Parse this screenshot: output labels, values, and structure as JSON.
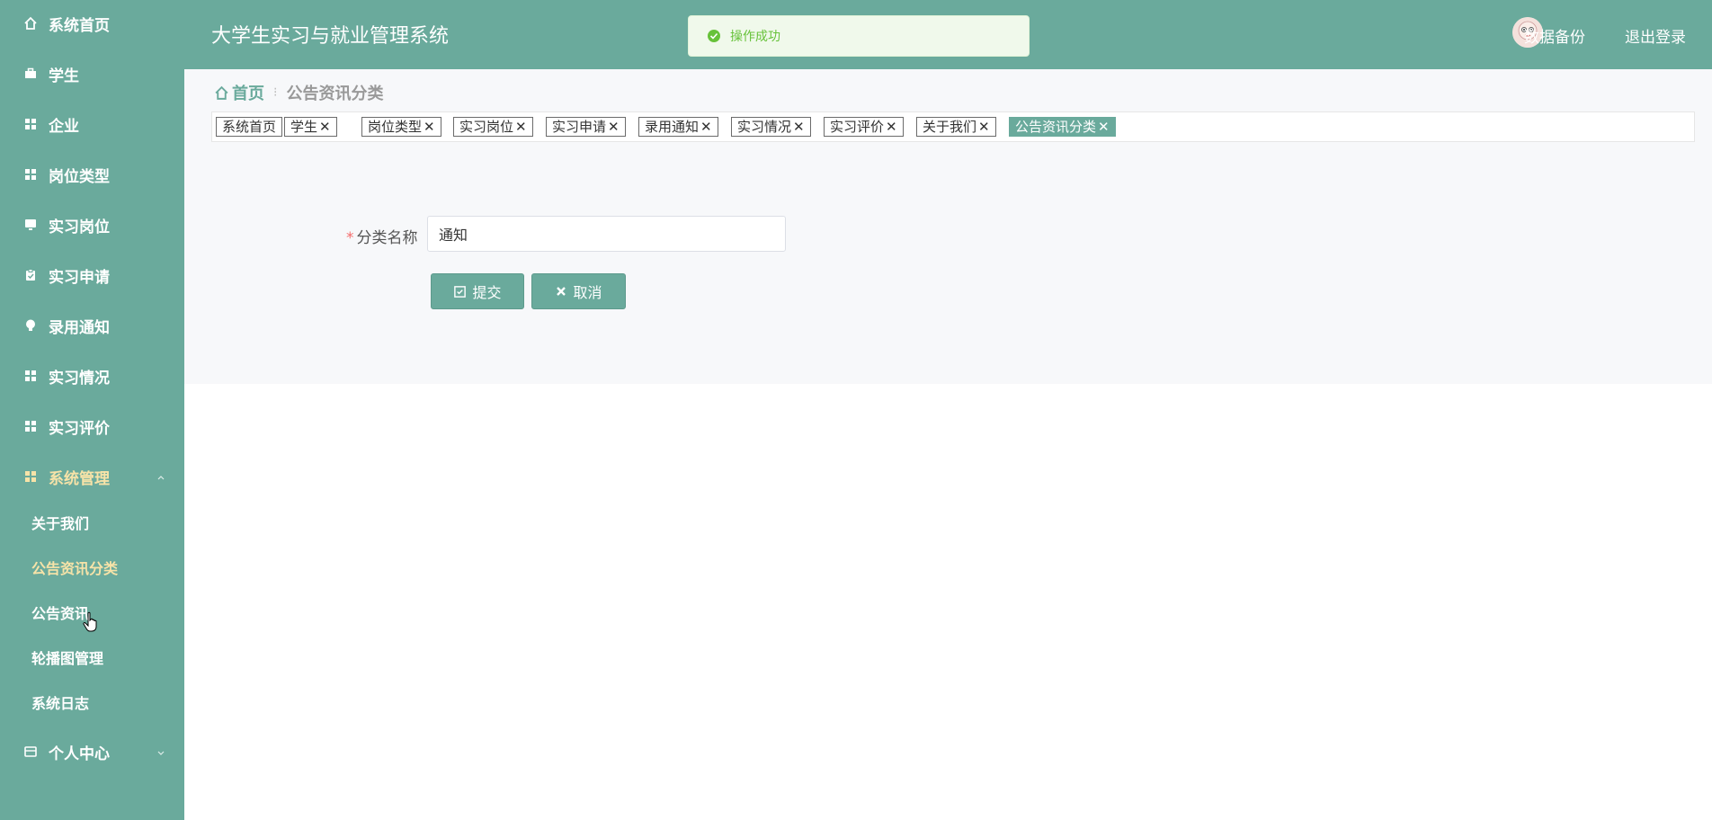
{
  "colors": {
    "primary": "#6aaa9c",
    "active_text": "#f7e3a8",
    "toast_bg": "#f0f9eb",
    "toast_text": "#67c23a"
  },
  "app": {
    "title": "大学生实习与就业管理系统"
  },
  "header": {
    "backup": "数据备份",
    "logout": "退出登录"
  },
  "toast": {
    "message": "操作成功",
    "icon": "check-circle-icon"
  },
  "sidebar": {
    "items": [
      {
        "label": "系统首页",
        "icon": "home-icon"
      },
      {
        "label": "学生",
        "icon": "briefcase-icon"
      },
      {
        "label": "企业",
        "icon": "grid-icon"
      },
      {
        "label": "岗位类型",
        "icon": "grid-icon"
      },
      {
        "label": "实习岗位",
        "icon": "monitor-icon"
      },
      {
        "label": "实习申请",
        "icon": "clipboard-icon"
      },
      {
        "label": "录用通知",
        "icon": "bulb-icon"
      },
      {
        "label": "实习情况",
        "icon": "grid-icon"
      },
      {
        "label": "实习评价",
        "icon": "grid-icon"
      }
    ],
    "system": {
      "label": "系统管理",
      "icon": "grid-icon",
      "children": [
        "关于我们",
        "公告资讯分类",
        "公告资讯",
        "轮播图管理",
        "系统日志"
      ]
    },
    "personal": {
      "label": "个人中心",
      "icon": "card-icon"
    }
  },
  "breadcrumb": {
    "home": "首页",
    "current": "公告资讯分类"
  },
  "tags": [
    "系统首页",
    "学生",
    "岗位类型",
    "实习岗位",
    "实习申请",
    "录用通知",
    "实习情况",
    "实习评价",
    "关于我们",
    "公告资讯分类"
  ],
  "form": {
    "label": "分类名称",
    "required_mark": "*",
    "value": "通知",
    "submit": "提交",
    "cancel": "取消"
  }
}
